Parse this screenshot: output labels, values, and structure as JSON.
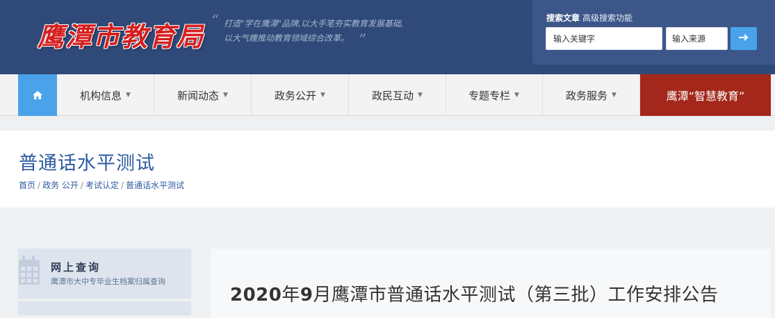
{
  "header": {
    "logo_text": "鹰潭市教育局",
    "quote_line1": "打造\"学在鹰潭\"品牌,以大手笔夯实教育发展基础,",
    "quote_line2": "以大气魄推动教育领域综合改革。",
    "quote_open": "“",
    "quote_close": "”"
  },
  "search": {
    "label": "搜索文章",
    "advanced_label": "高级搜索功能",
    "keyword_placeholder": "输入关键字",
    "source_placeholder": "输入来源",
    "go_icon": "arrow-right-icon"
  },
  "nav": {
    "home_icon": "home-icon",
    "items": [
      {
        "label": "机构信息"
      },
      {
        "label": "新闻动态"
      },
      {
        "label": "政务公开"
      },
      {
        "label": "政民互动"
      },
      {
        "label": "专题专栏"
      },
      {
        "label": "政务服务"
      }
    ],
    "special_label": "鹰潭“智慧教育”"
  },
  "page": {
    "title": "普通话水平测试",
    "breadcrumb": [
      "首页",
      "政务 公开",
      "考试认定",
      "普通话水平测试"
    ]
  },
  "sidebar": {
    "card_title": "网上查询",
    "card_subtitle": "鹰潭市大中专毕业生档案归属查询",
    "card_icon": "calendar-icon"
  },
  "article": {
    "title_prefix_year": "2020",
    "title_year_unit": "年",
    "title_month": "9",
    "title_rest": "月鹰潭市普通话水平测试（第三批）工作安排公告"
  },
  "colors": {
    "header_bg": "#2f4a79",
    "accent_blue": "#4aa3ea",
    "special_red": "#a3271a",
    "title_blue": "#2e5aa1"
  }
}
